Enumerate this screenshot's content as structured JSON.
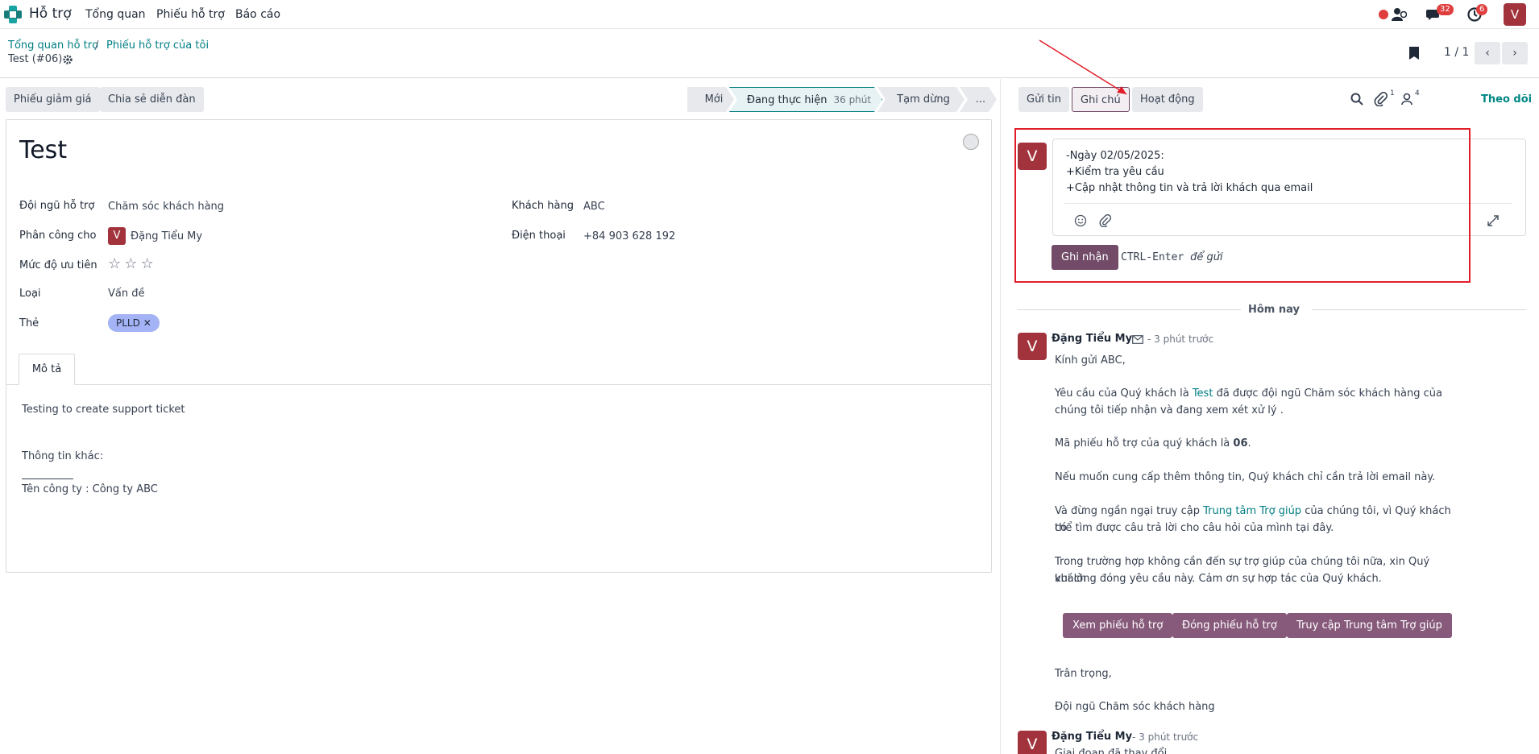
{
  "navbar": {
    "app_title": "Hỗ trợ",
    "menu": [
      "Tổng quan",
      "Phiếu hỗ trợ",
      "Báo cáo"
    ],
    "messages_count": "32",
    "activities_count": "6",
    "user_initial": "V"
  },
  "breadcrumb": {
    "items": [
      "Tổng quan hỗ trợ",
      "Phiếu hỗ trợ của tôi"
    ],
    "separator": "/",
    "record": "Test (#06)"
  },
  "pager": {
    "value": "1 / 1",
    "prev": "‹",
    "next": "›"
  },
  "actions": {
    "coupon": "Phiếu giảm giá",
    "forum": "Chia sẻ diễn đàn"
  },
  "stages": {
    "items": [
      {
        "label": "Mới",
        "time": ""
      },
      {
        "label": "Đang thực hiện",
        "time": "36 phút"
      },
      {
        "label": "Tạm dừng",
        "time": ""
      },
      {
        "label": "...",
        "time": ""
      }
    ],
    "active": "Đang thực hiện"
  },
  "form": {
    "title": "Test",
    "fields_left": [
      {
        "label": "Đội ngũ hỗ trợ",
        "value": "Chăm sóc khách hàng"
      },
      {
        "label": "Phân công cho",
        "value": "Đặng Tiểu My",
        "avatar": "V"
      },
      {
        "label": "Mức độ ưu tiên",
        "value": ""
      },
      {
        "label": "Loại",
        "value": "Vấn đề"
      },
      {
        "label": "Thẻ",
        "value": "PLLD"
      }
    ],
    "fields_right": [
      {
        "label": "Khách hàng",
        "value": "ABC"
      },
      {
        "label": "Điện thoại",
        "value": "+84 903 628 192"
      }
    ],
    "priority_stars": 0,
    "tag_remove": "✕",
    "tab": "Mô tả",
    "description": [
      "Testing to create support ticket",
      "Thông tin khác:",
      "Tên công ty : Công ty ABC"
    ]
  },
  "chatter": {
    "tabs": [
      "Gửi tin",
      "Ghi chú",
      "Hoạt động"
    ],
    "active_tab": "Ghi chú",
    "attachments_count": "1",
    "followers_count": "4",
    "follow": "Theo dõi",
    "composer": {
      "avatar": "V",
      "lines": [
        "-Ngày 02/05/2025:",
        "+Kiểm tra yêu cầu",
        "+Cập nhật thông tin và trả lời khách qua email"
      ],
      "submit": "Ghi nhận",
      "hint_key": "CTRL-Enter",
      "hint_text": "để gửi"
    },
    "today": "Hôm nay",
    "messages": [
      {
        "author": "Đặng Tiểu My",
        "time": "- 3 phút trước",
        "avatar": "V",
        "greeting": "Kính gửi ABC,",
        "p1_a": "Yêu cầu của Quý khách là ",
        "p1_link": "Test",
        "p1_b": " đã được đội ngũ Chăm sóc khách hàng của",
        "p1_c": "chúng tôi tiếp nhận và đang xem xét xử lý .",
        "p2_a": "Mã phiếu hỗ trợ của quý khách là ",
        "p2_bold": "06",
        "p2_b": ".",
        "p3": "Nếu muốn cung cấp thêm thông tin, Quý khách chỉ cần trả lời email này.",
        "p4_a": "Và đừng ngần ngại truy cập ",
        "p4_link": "Trung tâm Trợ giúp",
        "p4_b": " của chúng tôi, vì Quý khách có",
        "p4_c": "thể tìm được câu trả lời cho câu hỏi của mình tại đây.",
        "p5_a": "Trong trường hợp không cần đến sự trợ giúp của chúng tôi nữa, xin Quý khách",
        "p5_b": "vui lòng đóng yêu cầu này. Cảm ơn sự hợp tác của Quý khách.",
        "buttons": [
          "Xem phiếu hỗ trợ",
          "Đóng phiếu hỗ trợ",
          "Truy cập Trung tâm Trợ giúp"
        ],
        "closing": "Trân trọng,",
        "signature": "Đội ngũ Chăm sóc khách hàng"
      },
      {
        "author": "Đặng Tiểu My",
        "time": "- 3 phút trước",
        "avatar": "V",
        "preview": "Giai đoạn đã thay đổi"
      }
    ]
  },
  "colors": {
    "brand": "#714b67",
    "teal": "#017e84",
    "avatar": "#a2333c",
    "highlight": "#e11d2a",
    "tag": "#a4b3f5"
  }
}
